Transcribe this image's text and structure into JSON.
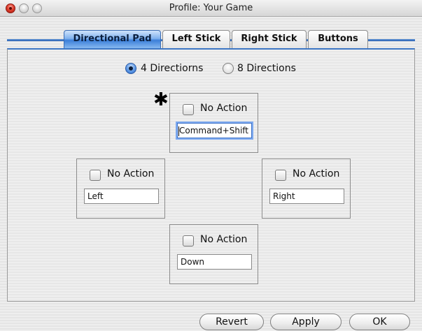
{
  "window": {
    "title": "Profile: Your Game"
  },
  "tabs": [
    {
      "label": "Directional Pad",
      "active": true
    },
    {
      "label": "Left Stick",
      "active": false
    },
    {
      "label": "Right Stick",
      "active": false
    },
    {
      "label": "Buttons",
      "active": false
    }
  ],
  "mode": {
    "options": [
      {
        "label": "4 Directiorns",
        "selected": true
      },
      {
        "label": "8 Directions",
        "selected": false
      }
    ]
  },
  "indicator": "✱",
  "directions": {
    "up": {
      "checkbox_label": "No Action",
      "checked": false,
      "value": "Command+Shift"
    },
    "left": {
      "checkbox_label": "No Action",
      "checked": false,
      "value": "Left"
    },
    "right": {
      "checkbox_label": "No Action",
      "checked": false,
      "value": "Right"
    },
    "down": {
      "checkbox_label": "No Action",
      "checked": false,
      "value": "Down"
    }
  },
  "buttons": {
    "revert": "Revert",
    "apply": "Apply",
    "ok": "OK"
  },
  "colors": {
    "accent": "#3c7fd9",
    "close": "#e0402f"
  },
  "icons": {
    "close": "close-light-icon",
    "minimize": "minimize-light-icon",
    "zoom": "zoom-light-icon"
  }
}
